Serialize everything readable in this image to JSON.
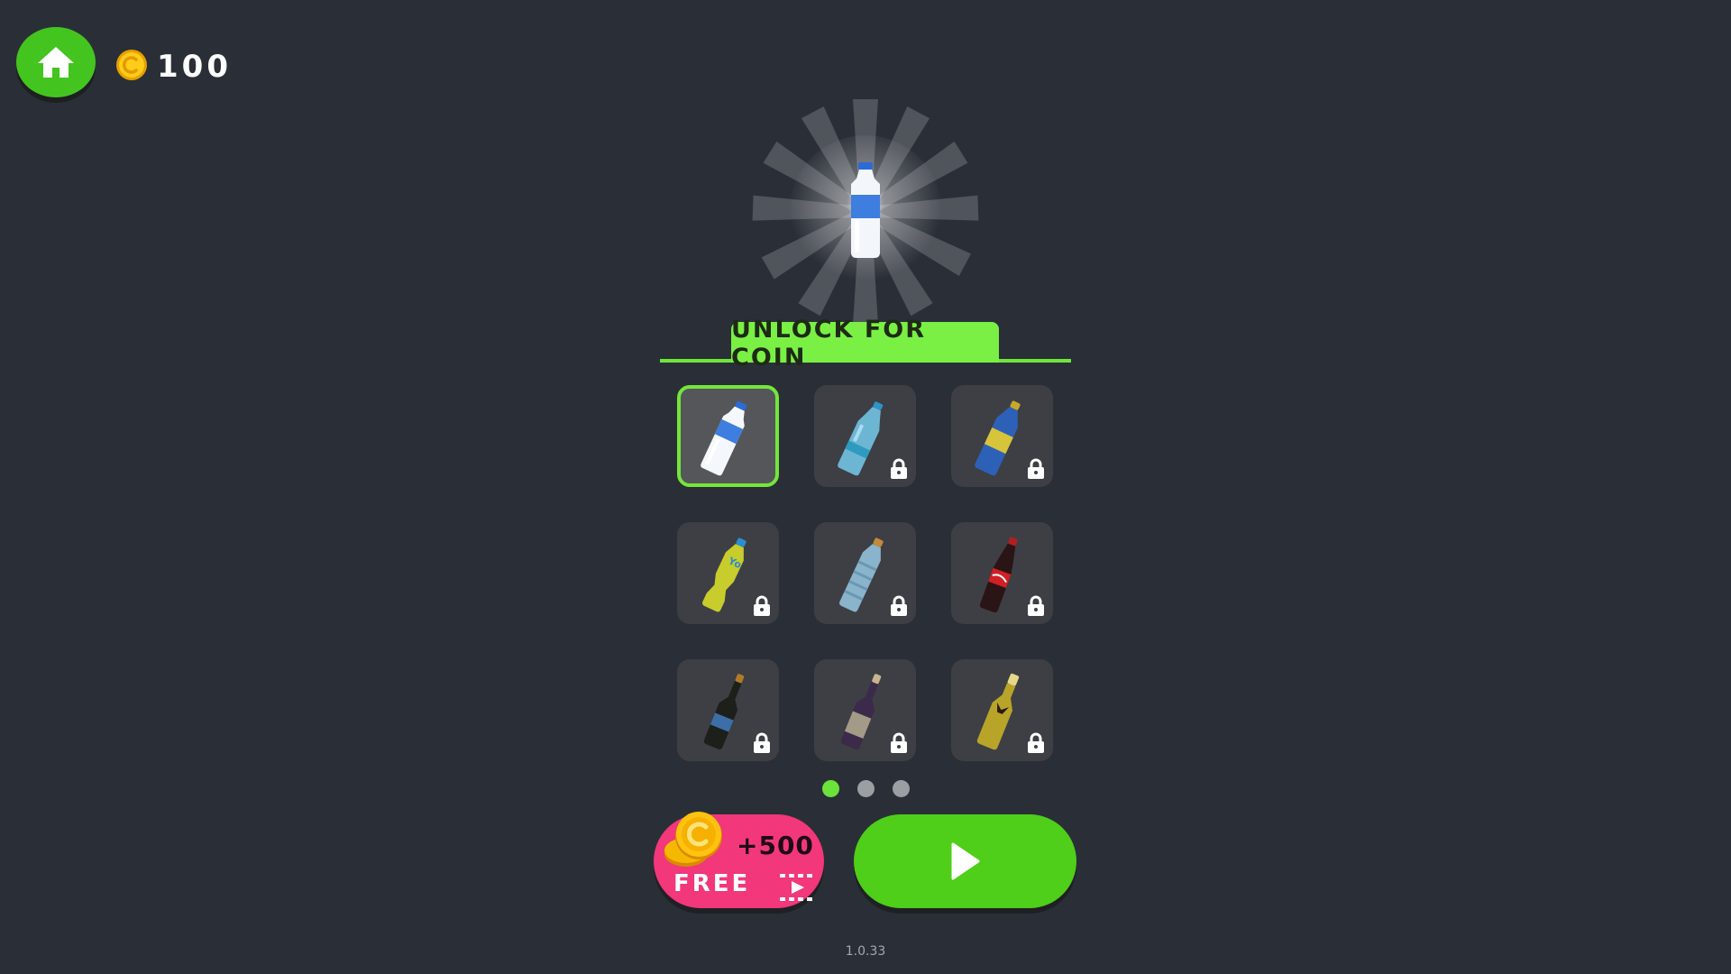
{
  "hud": {
    "home_icon": "home-icon",
    "coin_icon": "coin-icon",
    "coins": "100"
  },
  "featured": {
    "item": "white-blue-water-bottle"
  },
  "section": {
    "title": "UNLOCK FOR COIN"
  },
  "grid": {
    "items": [
      {
        "name": "white-blue-water-bottle",
        "locked": false,
        "selected": true
      },
      {
        "name": "light-blue-water-bottle",
        "locked": true,
        "selected": false
      },
      {
        "name": "blue-yellow-bottle",
        "locked": true,
        "selected": false
      },
      {
        "name": "yellow-juice-bottle",
        "locked": true,
        "selected": false
      },
      {
        "name": "ridged-water-bottle",
        "locked": true,
        "selected": false
      },
      {
        "name": "cola-bottle",
        "locked": true,
        "selected": false
      },
      {
        "name": "dark-wine-bottle",
        "locked": true,
        "selected": false
      },
      {
        "name": "purple-wine-bottle",
        "locked": true,
        "selected": false
      },
      {
        "name": "champagne-bottle",
        "locked": true,
        "selected": false
      }
    ]
  },
  "pagination": {
    "pages": 3,
    "current": 1
  },
  "buttons": {
    "reward_amount": "+500",
    "reward_label": "FREE",
    "play_icon": "play-icon",
    "video_icon": "video-icon"
  },
  "version": "1.0.33",
  "colors": {
    "background": "#2a2f37",
    "accent_green": "#6be33a",
    "play_green": "#4fce1a",
    "reward_pink": "#f2377a",
    "coin_gold": "#f5b800"
  }
}
